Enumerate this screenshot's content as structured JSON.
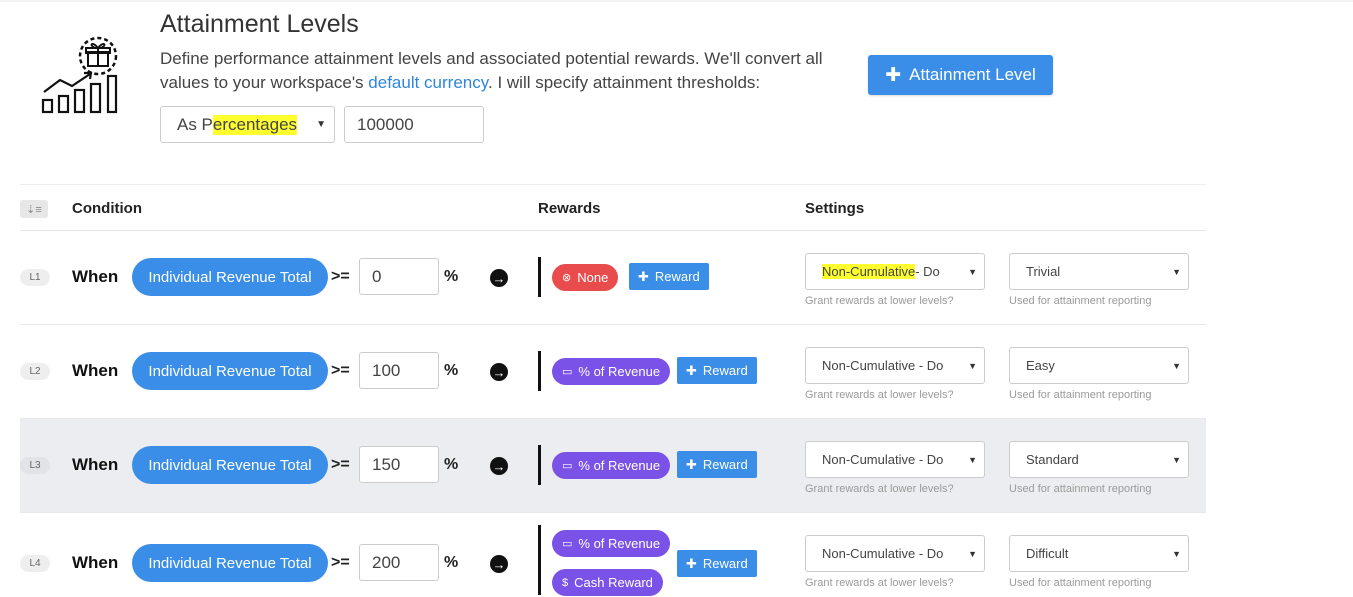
{
  "header": {
    "title": "Attainment Levels",
    "description_before": "Define performance attainment levels and associated potential rewards. We'll convert all values to your workspace's ",
    "description_link": "default currency",
    "description_after": ". I will specify attainment thresholds:",
    "add_level_label": "Attainment Level",
    "threshold_mode_prefix": "As P",
    "threshold_mode_highlight": "ercentages",
    "threshold_value": "100000",
    "icon": "gift-growth-chart-icon"
  },
  "table": {
    "columns": {
      "condition": "Condition",
      "rewards": "Rewards",
      "settings": "Settings"
    },
    "sort_icon": "sort-icon",
    "cumulative_hint": "Grant rewards at lower levels?",
    "difficulty_hint": "Used for attainment reporting",
    "rows": [
      {
        "level": "L1",
        "when": "When",
        "metric": "Individual Revenue Total",
        "operator": ">=",
        "value": "0",
        "unit": "%",
        "rewards": [
          {
            "label": "None",
            "icon": "x-circle-icon",
            "kind": "none"
          }
        ],
        "add_reward_label": "Reward",
        "cumulative_highlight": "Non-Cumulative",
        "cumulative_rest": " - Do",
        "difficulty": "Trivial"
      },
      {
        "level": "L2",
        "when": "When",
        "metric": "Individual Revenue Total",
        "operator": ">=",
        "value": "100",
        "unit": "%",
        "rewards": [
          {
            "label": "% of Revenue",
            "icon": "card-icon",
            "kind": "rev"
          }
        ],
        "add_reward_label": "Reward",
        "cumulative": "Non-Cumulative - Do",
        "difficulty": "Easy"
      },
      {
        "level": "L3",
        "when": "When",
        "metric": "Individual Revenue Total",
        "operator": ">=",
        "value": "150",
        "unit": "%",
        "rewards": [
          {
            "label": "% of Revenue",
            "icon": "card-icon",
            "kind": "rev"
          }
        ],
        "add_reward_label": "Reward",
        "cumulative": "Non-Cumulative - Do",
        "difficulty": "Standard"
      },
      {
        "level": "L4",
        "when": "When",
        "metric": "Individual Revenue Total",
        "operator": ">=",
        "value": "200",
        "unit": "%",
        "rewards": [
          {
            "label": "% of Revenue",
            "icon": "card-icon",
            "kind": "rev"
          },
          {
            "label": "Cash Reward",
            "icon": "dollar-icon",
            "kind": "cash"
          }
        ],
        "add_reward_label": "Reward",
        "cumulative": "Non-Cumulative - Do",
        "difficulty": "Difficult"
      }
    ]
  }
}
